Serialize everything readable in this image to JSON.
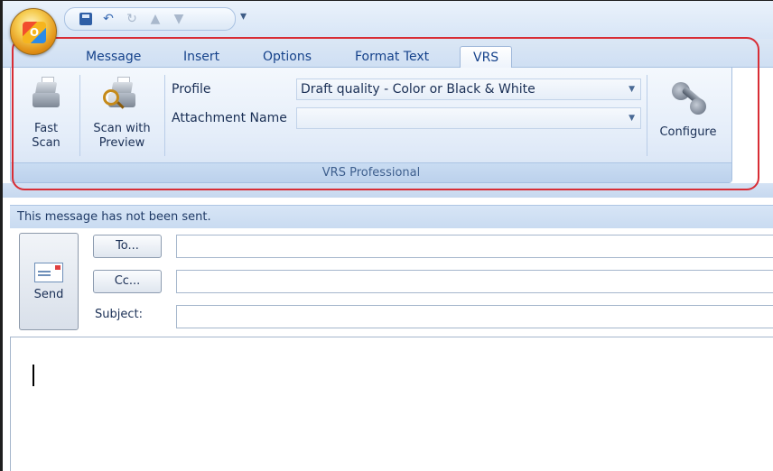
{
  "quick_access": {
    "icons": [
      "save-icon",
      "undo-icon",
      "redo-icon",
      "up-arrow-icon",
      "down-arrow-icon"
    ],
    "more": "▾"
  },
  "tabs": [
    {
      "label": "Message"
    },
    {
      "label": "Insert"
    },
    {
      "label": "Options"
    },
    {
      "label": "Format Text"
    },
    {
      "label": "VRS",
      "active": true
    }
  ],
  "ribbon": {
    "fast_scan": {
      "line1": "Fast",
      "line2": "Scan"
    },
    "scan_with_preview": {
      "line1": "Scan with",
      "line2": "Preview"
    },
    "profile": {
      "label": "Profile",
      "value": "Draft quality - Color or Black & White"
    },
    "attachment_name": {
      "label": "Attachment Name",
      "value": ""
    },
    "configure": {
      "label": "Configure"
    },
    "group_caption": "VRS Professional"
  },
  "infobar": {
    "text": "This message has not been sent."
  },
  "compose": {
    "send_label": "Send",
    "to_label": "To...",
    "cc_label": "Cc...",
    "subject_label": "Subject:",
    "to_value": "",
    "cc_value": "",
    "subject_value": ""
  },
  "colors": {
    "highlight": "#d82d35",
    "ribbon_bg": "#e4edf9",
    "tab_text": "#15428b"
  }
}
